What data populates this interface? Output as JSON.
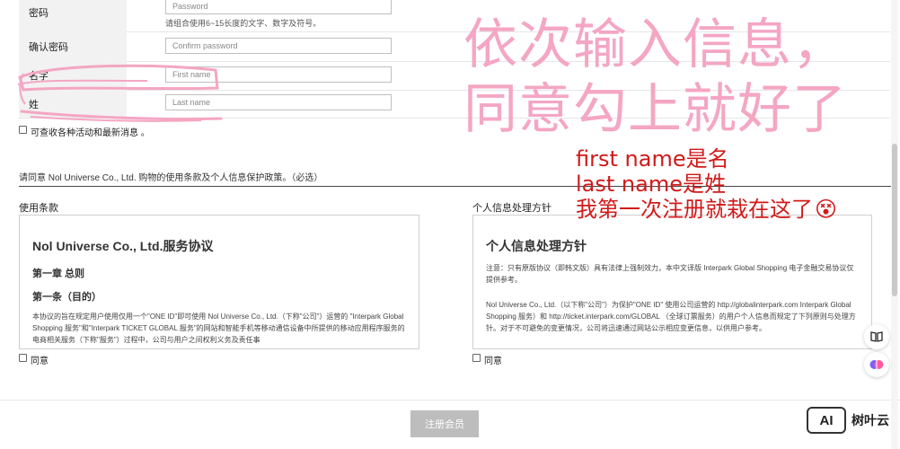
{
  "form": {
    "password": {
      "label": "密码",
      "placeholder": "Password",
      "hint": "请组合使用6~15长度的文字、数字及符号。"
    },
    "confirm": {
      "label": "确认密码",
      "placeholder": "Confirm password"
    },
    "first_name": {
      "label": "名字",
      "placeholder": "First name"
    },
    "last_name": {
      "label": "姓",
      "placeholder": "Last name"
    },
    "newsletter": "可查收各种活动和最新消息 。"
  },
  "consent": {
    "heading": "请同意 Nol Universe Co., Ltd. 购物的使用条款及个人信息保护政策。（必选）",
    "terms": {
      "title": "使用条款",
      "h1": "Nol Universe Co., Ltd.服务协议",
      "h2": "第一章 总则",
      "h3": "第一条（目的）",
      "body": "本协议的旨在规定用户使用仅用一个\"ONE ID\"即可使用 Nol Universe Co., Ltd.（下称\"公司\"）运营的 \"Interpark Global Shopping 服务\"和\"Interpark TICKET GLOBAL 服务\"的网站和智能手机等移动通信设备中所提供的移动应用程序服务的电商相关服务（下称\"服务\"）过程中，公司与用户之间权利义务及责任事",
      "agree": "同意"
    },
    "privacy": {
      "title": "个人信息处理方针",
      "h1": "个人信息处理方针",
      "note": "注意：只有原版协议（即韩文版）具有法律上强制效力，本中文译版 Interpark Global Shopping 电子金融交易协议仅提供参考。",
      "body": "Nol Universe Co., Ltd.（以下称\"公司\"）为保护\"ONE ID\" 使用公司运营的 http://globalinterpark.com Interpark Global Shopping 服务）和 http://ticket.interpark.com/GLOBAL （全球订票服务）的用户个人信息而规定了下列原则与处理方针。对于不可避免的变更情况，公司将迅速通过网站公示相应变更信息，以供用户参考。",
      "agree": "同意"
    }
  },
  "submit_label": "注册会员",
  "overlay": {
    "pink_line1": "依次输入信息，",
    "pink_line2": "同意勾上就好了",
    "red_line1": "first name是名",
    "red_line2": "last name是姓",
    "red_line3": "我第一次注册就栽在这了",
    "emoji": "😵"
  },
  "watermark": {
    "logo": "AI",
    "text": "树叶云"
  },
  "colors": {
    "pink": "#f4a6c3",
    "red": "#d11a1a",
    "button": "#bdbdbd"
  }
}
